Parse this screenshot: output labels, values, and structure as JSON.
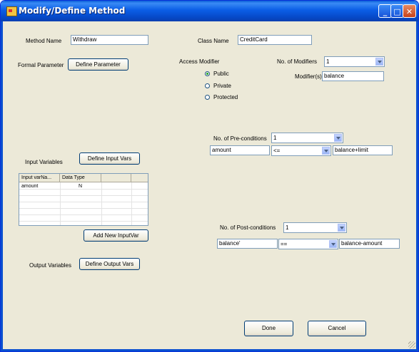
{
  "window": {
    "title": "Modify/Define Method",
    "min": "_",
    "max": "□",
    "close": "✕"
  },
  "method": {
    "label": "Method Name",
    "value": "Withdraw"
  },
  "class": {
    "label": "Class Name",
    "value": "CreditCard"
  },
  "formal": {
    "label": "Formal Parameter",
    "button": "Define Parameter"
  },
  "access": {
    "label": "Access Modifier",
    "options": [
      "Public",
      "Private",
      "Protected"
    ],
    "selected": "Public"
  },
  "modifiers": {
    "count_label": "No. of Modifiers",
    "count_value": "1",
    "label": "Modifier(s)",
    "value": "balance"
  },
  "pre": {
    "label": "No. of Pre-conditions",
    "count_value": "1",
    "left": "amount",
    "op": "<=",
    "right": "balance+limit"
  },
  "post": {
    "label": "No. of Post-conditions",
    "count_value": "1",
    "left": "balance'",
    "op": "==",
    "right": "balance-amount"
  },
  "input": {
    "label": "Input Variables",
    "button": "Define Input Vars",
    "columns": [
      "Input varNa...",
      "Data Type"
    ],
    "rows": [
      {
        "name": "amount",
        "type": "N"
      }
    ],
    "add_button": "Add New InputVar"
  },
  "output": {
    "label": "Output Variables",
    "button": "Define Output Vars"
  },
  "actions": {
    "done": "Done",
    "cancel": "Cancel"
  }
}
